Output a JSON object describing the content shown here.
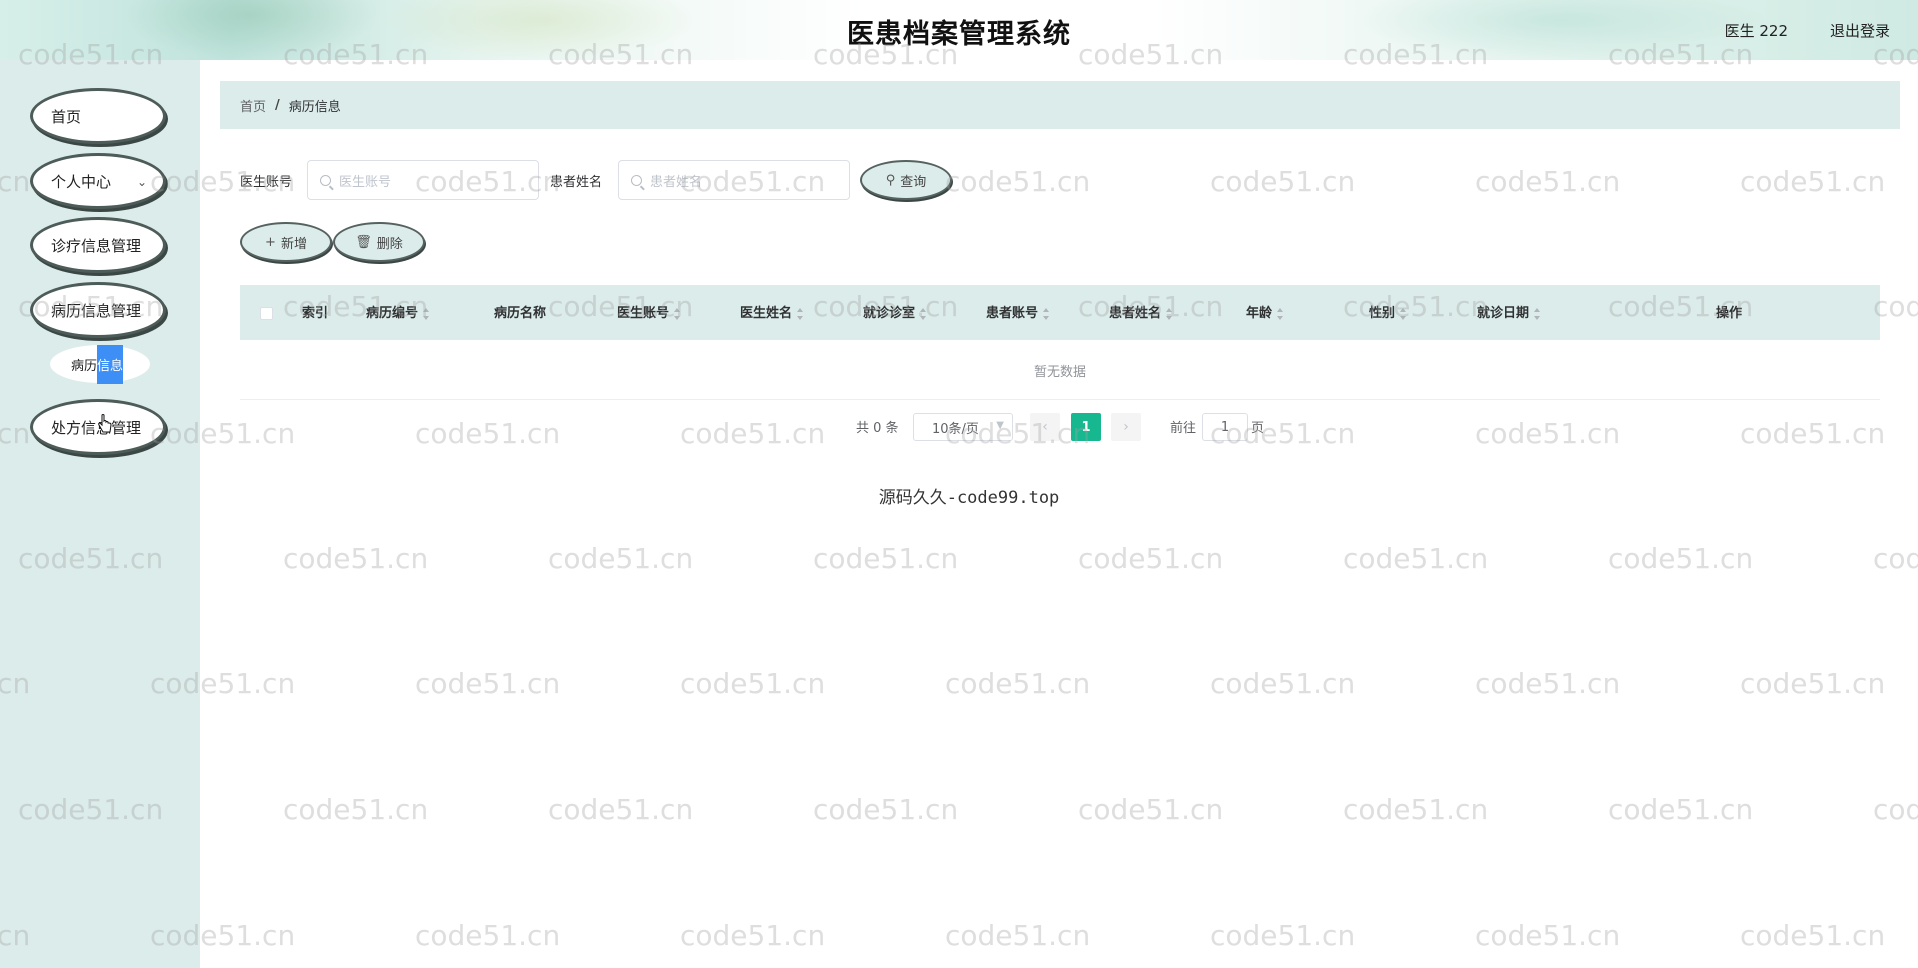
{
  "header": {
    "title": "医患档案管理系统",
    "user": "医生 222",
    "logout": "退出登录"
  },
  "sidebar": {
    "items": [
      {
        "label": "首页"
      },
      {
        "label": "个人中心"
      },
      {
        "label": "诊疗信息管理"
      },
      {
        "label": "病历信息管理"
      },
      {
        "label": "处方信息管理"
      }
    ],
    "submenu": {
      "label_a": "病历",
      "label_b": "信息"
    }
  },
  "breadcrumb": {
    "home": "首页",
    "separator": "/",
    "current": "病历信息"
  },
  "search": {
    "field1_label": "医生账号",
    "field1_placeholder": "医生账号",
    "field2_label": "患者姓名",
    "field2_placeholder": "患者姓名",
    "query_button": "查询"
  },
  "actions": {
    "add": "新增",
    "delete": "删除"
  },
  "table": {
    "columns": [
      "索引",
      "病历编号",
      "病历名称",
      "医生账号",
      "医生姓名",
      "就诊诊室",
      "患者账号",
      "患者姓名",
      "年龄",
      "性别",
      "就诊日期",
      "操作"
    ],
    "empty_text": "暂无数据"
  },
  "pagination": {
    "total": "共 0 条",
    "page_size": "10条/页",
    "current_page": "1",
    "goto_label": "前往",
    "goto_value": "1",
    "page_suffix": "页"
  },
  "footer": "源码久久-code99.top",
  "watermark": "code51.cn",
  "colors": {
    "accent": "#17b890",
    "panel": "#dbecea",
    "highlight": "#3d8ff5"
  }
}
